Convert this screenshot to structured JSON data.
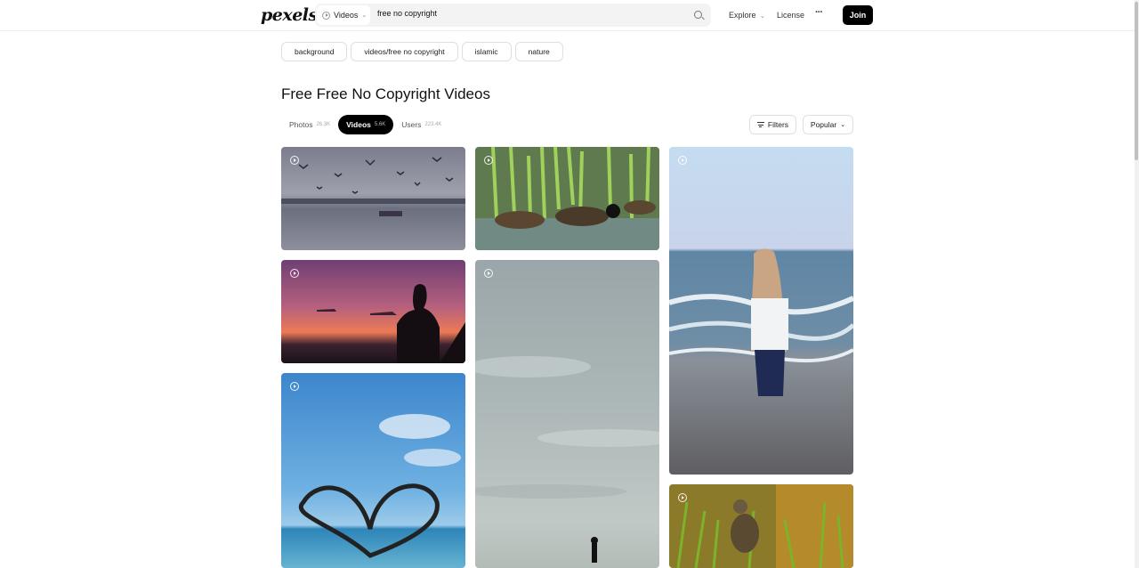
{
  "header": {
    "logo": "pexels",
    "search": {
      "type_label": "Videos",
      "query": "free no copyright"
    },
    "nav": {
      "explore": "Explore",
      "license": "License",
      "more": "···"
    },
    "join_label": "Join"
  },
  "related_searches": [
    "background",
    "videos/free no copyright",
    "islamic",
    "nature"
  ],
  "page_title": "Free Free No Copyright Videos",
  "tabs": [
    {
      "label": "Photos",
      "count": "26.3K"
    },
    {
      "label": "Videos",
      "count": "5.6K",
      "active": true
    },
    {
      "label": "Users",
      "count": "223.4K"
    }
  ],
  "filters_label": "Filters",
  "sort_label": "Popular",
  "videos": [
    {
      "subject": "seagulls-over-water"
    },
    {
      "subject": "geese-in-reeds"
    },
    {
      "subject": "woman-on-beach"
    },
    {
      "subject": "silhouette-sunset"
    },
    {
      "subject": "person-on-cloudy-shore"
    },
    {
      "subject": "heart-palm-leaves"
    },
    {
      "subject": "bird-in-grass"
    }
  ]
}
